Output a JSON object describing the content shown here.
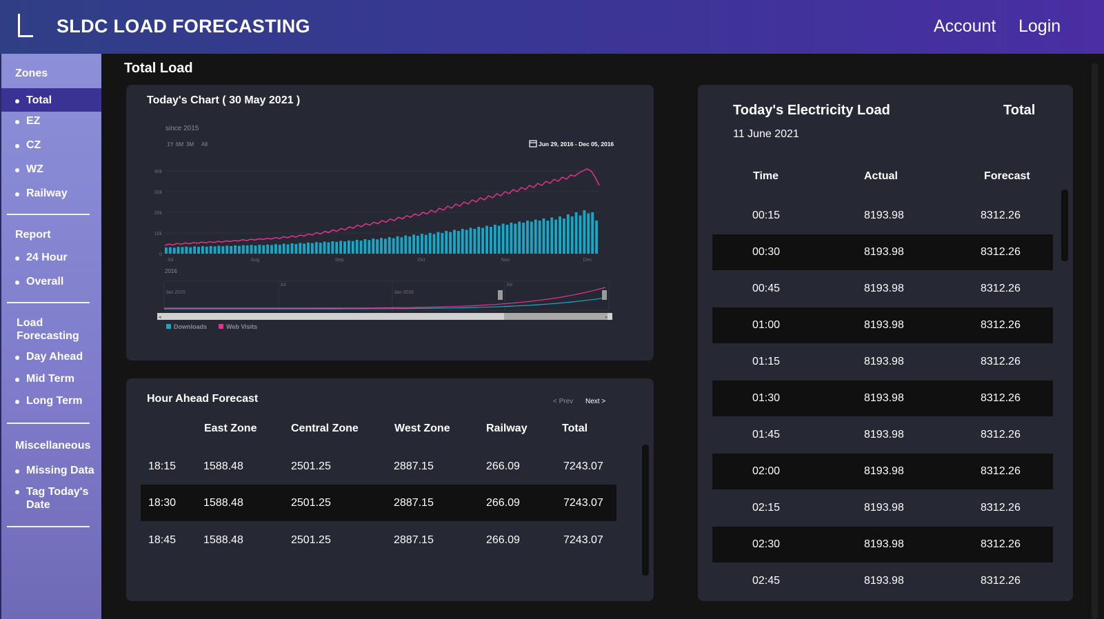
{
  "header": {
    "title": "SLDC LOAD FORECASTING",
    "account": "Account",
    "login": "Login"
  },
  "sidebar": {
    "zones_heading": "Zones",
    "zones": [
      "Total",
      "EZ",
      "CZ",
      "WZ",
      "Railway"
    ],
    "report_heading": "Report",
    "report_items": [
      "24 Hour",
      "Overall"
    ],
    "load_heading": "Load Forecasting",
    "load_items": [
      "Day Ahead",
      "Mid Term",
      "Long Term"
    ],
    "misc_heading": "Miscellaneous",
    "misc_items": [
      "Missing Data",
      "Tag Today's Date"
    ]
  },
  "main": {
    "title": "Total Load"
  },
  "chart_card": {
    "title": "Today's Chart ( 30 May 2021 )",
    "subtitle": "since 2015",
    "range_buttons": [
      "1Y",
      "6M",
      "3M",
      "All"
    ],
    "date_range": "Jun 29, 2016 - Dec 05, 2016",
    "year_label": "2016",
    "nav_labels": [
      "Jan 2015",
      "Jul",
      "Jan 2016",
      "Jul"
    ]
  },
  "chart_data": {
    "type": "bar",
    "x_ticks": [
      "Jul",
      "Aug",
      "Sep",
      "Oct",
      "Nov",
      "Dec"
    ],
    "y_ticks": [
      "0",
      "10k",
      "20k",
      "30k",
      "40k"
    ],
    "ylim": [
      0,
      40000
    ],
    "legend_position": "bottom-left",
    "series": [
      {
        "name": "Downloads",
        "type": "bar",
        "color": "#17a8c8",
        "values": [
          3000,
          3100,
          2900,
          3300,
          3200,
          3400,
          3100,
          3500,
          3300,
          3600,
          3400,
          3700,
          3500,
          3800,
          3600,
          3900,
          3700,
          4000,
          3800,
          4100,
          4000,
          4200,
          3900,
          4300,
          4100,
          4400,
          4200,
          4600,
          4300,
          4800,
          4500,
          5000,
          4700,
          5200,
          4900,
          5400,
          5100,
          5600,
          5300,
          5800,
          5500,
          6000,
          5700,
          6200,
          5900,
          6400,
          6100,
          6700,
          6300,
          7000,
          6600,
          7300,
          6900,
          7600,
          7200,
          8000,
          7500,
          8400,
          7900,
          8800,
          8300,
          9200,
          8700,
          9600,
          9100,
          10000,
          9500,
          10500,
          10000,
          11000,
          10500,
          11500,
          11000,
          12000,
          11500,
          12500,
          12000,
          13000,
          12500,
          13500,
          13000,
          14000,
          13500,
          14500,
          14000,
          15000,
          14500,
          15500,
          15000,
          16000,
          15500,
          16500,
          16000,
          17000,
          16000,
          17500,
          16500,
          18000,
          17000,
          19000,
          18000,
          20000,
          18500,
          21000,
          19500,
          20000,
          16000
        ]
      },
      {
        "name": "Web Visits",
        "type": "line",
        "color": "#e5348f",
        "values": [
          4000,
          4600,
          4200,
          5000,
          4500,
          5200,
          4800,
          5400,
          5000,
          5600,
          5200,
          5800,
          5400,
          6000,
          5600,
          6200,
          5900,
          6400,
          6100,
          6800,
          6300,
          7000,
          6600,
          7200,
          6900,
          7400,
          7100,
          7800,
          7300,
          8200,
          7700,
          8600,
          8000,
          9000,
          8500,
          9500,
          9000,
          10200,
          9500,
          10800,
          10200,
          11500,
          10800,
          12200,
          11500,
          13000,
          12300,
          13800,
          13000,
          14500,
          13800,
          15200,
          14500,
          16000,
          15200,
          16800,
          16000,
          17600,
          16800,
          18400,
          17600,
          19200,
          18400,
          20000,
          19200,
          21000,
          20000,
          22000,
          21000,
          23000,
          22000,
          24000,
          23000,
          25000,
          24000,
          26000,
          25000,
          27000,
          26000,
          28000,
          27000,
          29000,
          28000,
          30000,
          29000,
          31000,
          30000,
          32000,
          31000,
          33000,
          32000,
          34000,
          33000,
          35000,
          34000,
          36000,
          35000,
          37000,
          36000,
          38000,
          37500,
          39000,
          40000,
          41000,
          40000,
          37000,
          33000
        ]
      }
    ]
  },
  "hour_ahead": {
    "title": "Hour Ahead Forecast",
    "prev": "< Prev",
    "next": "Next >",
    "columns": [
      "East Zone",
      "Central Zone",
      "West Zone",
      "Railway",
      "Total"
    ],
    "rows": [
      [
        "18:15",
        "1588.48",
        "2501.25",
        "2887.15",
        "266.09",
        "7243.07"
      ],
      [
        "18:30",
        "1588.48",
        "2501.25",
        "2887.15",
        "266.09",
        "7243.07"
      ],
      [
        "18:45",
        "1588.48",
        "2501.25",
        "2887.15",
        "266.09",
        "7243.07"
      ]
    ]
  },
  "electricity": {
    "title": "Today's Electricity Load",
    "zone": "Total",
    "date": "11 June 2021",
    "columns": [
      "Time",
      "Actual",
      "Forecast"
    ],
    "rows": [
      [
        "00:15",
        "8193.98",
        "8312.26"
      ],
      [
        "00:30",
        "8193.98",
        "8312.26"
      ],
      [
        "00:45",
        "8193.98",
        "8312.26"
      ],
      [
        "01:00",
        "8193.98",
        "8312.26"
      ],
      [
        "01:15",
        "8193.98",
        "8312.26"
      ],
      [
        "01:30",
        "8193.98",
        "8312.26"
      ],
      [
        "01:45",
        "8193.98",
        "8312.26"
      ],
      [
        "02:00",
        "8193.98",
        "8312.26"
      ],
      [
        "02:15",
        "8193.98",
        "8312.26"
      ],
      [
        "02:30",
        "8193.98",
        "8312.26"
      ],
      [
        "02:45",
        "8193.98",
        "8312.26"
      ]
    ]
  }
}
